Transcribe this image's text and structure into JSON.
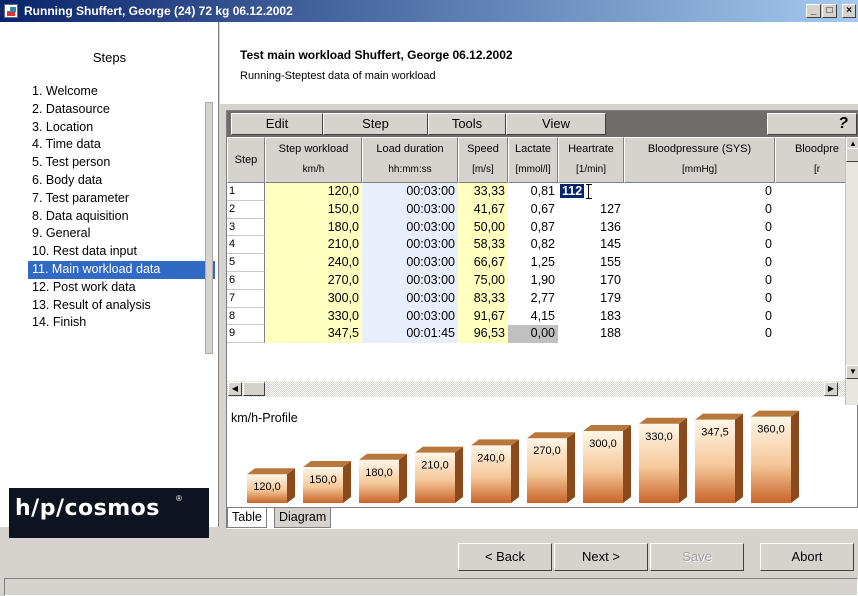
{
  "window": {
    "title": "Running Shuffert, George (24) 72 kg 06.12.2002",
    "buttons": [
      "_",
      "□",
      "×"
    ]
  },
  "sidebar": {
    "title": "Steps",
    "items": [
      "1. Welcome",
      "2. Datasource",
      "3. Location",
      "4. Time data",
      "5. Test person",
      "6. Body data",
      "7. Test parameter",
      "8. Data aquisition",
      "9. General",
      "10. Rest data input",
      "11. Main workload data",
      "12. Post work data",
      "13. Result of analysis",
      "14. Finish"
    ],
    "active_index": 10,
    "logo": "h/p/cosmos",
    "logo_reg": "®"
  },
  "header": {
    "title": "Test main workload Shuffert, George 06.12.2002",
    "subtitle": "Running-Steptest data of main workload"
  },
  "menu": {
    "items": [
      "Edit",
      "Step",
      "Tools",
      "View"
    ],
    "help": "?"
  },
  "table": {
    "columns": [
      {
        "l1": "Step",
        "l2": ""
      },
      {
        "l1": "Step workload",
        "l2": "km/h"
      },
      {
        "l1": "Load duration",
        "l2": "hh:mm:ss"
      },
      {
        "l1": "Speed",
        "l2": "[m/s]"
      },
      {
        "l1": "Lactate",
        "l2": "[mmol/l]"
      },
      {
        "l1": "Heartrate",
        "l2": "[1/min]"
      },
      {
        "l1": "Bloodpressure (SYS)",
        "l2": "[mmHg]"
      },
      {
        "l1": "Bloodpre",
        "l2": "[r"
      }
    ],
    "rows": [
      {
        "step": "1",
        "workload": "120,0",
        "duration": "00:03:00",
        "speed": "33,33",
        "lactate": "0,81",
        "hr": "112",
        "sys": "0"
      },
      {
        "step": "2",
        "workload": "150,0",
        "duration": "00:03:00",
        "speed": "41,67",
        "lactate": "0,67",
        "hr": "127",
        "sys": "0"
      },
      {
        "step": "3",
        "workload": "180,0",
        "duration": "00:03:00",
        "speed": "50,00",
        "lactate": "0,87",
        "hr": "136",
        "sys": "0"
      },
      {
        "step": "4",
        "workload": "210,0",
        "duration": "00:03:00",
        "speed": "58,33",
        "lactate": "0,82",
        "hr": "145",
        "sys": "0"
      },
      {
        "step": "5",
        "workload": "240,0",
        "duration": "00:03:00",
        "speed": "66,67",
        "lactate": "1,25",
        "hr": "155",
        "sys": "0"
      },
      {
        "step": "6",
        "workload": "270,0",
        "duration": "00:03:00",
        "speed": "75,00",
        "lactate": "1,90",
        "hr": "170",
        "sys": "0"
      },
      {
        "step": "7",
        "workload": "300,0",
        "duration": "00:03:00",
        "speed": "83,33",
        "lactate": "2,77",
        "hr": "179",
        "sys": "0"
      },
      {
        "step": "8",
        "workload": "330,0",
        "duration": "00:03:00",
        "speed": "91,67",
        "lactate": "4,15",
        "hr": "183",
        "sys": "0"
      },
      {
        "step": "9",
        "workload": "347,5",
        "duration": "00:01:45",
        "speed": "96,53",
        "lactate": "0,00",
        "hr": "188",
        "sys": "0"
      }
    ]
  },
  "profile": {
    "title": "km/h-Profile",
    "bars": [
      "120,0",
      "150,0",
      "180,0",
      "210,0",
      "240,0",
      "270,0",
      "300,0",
      "330,0",
      "347,5",
      "360,0"
    ],
    "values": [
      120,
      150,
      180,
      210,
      240,
      270,
      300,
      330,
      347.5,
      360
    ]
  },
  "tabs": [
    "Table",
    "Diagram"
  ],
  "footer": {
    "back": "< Back",
    "next": "Next >",
    "save": "Save",
    "abort": "Abort"
  }
}
